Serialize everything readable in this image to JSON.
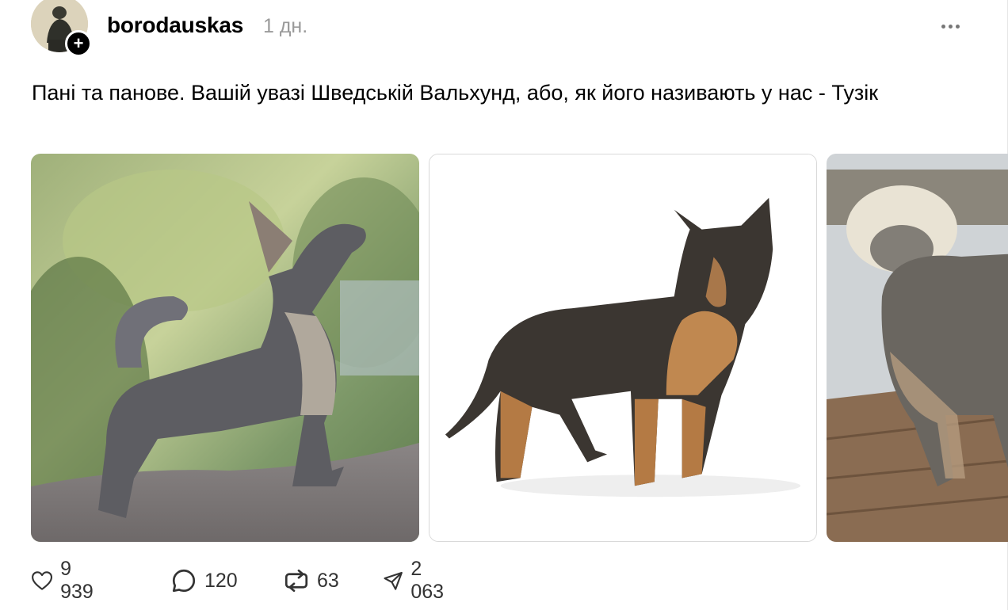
{
  "author": {
    "username": "borodauskas",
    "timestamp": "1 дн.",
    "follow_badge": "+"
  },
  "post": {
    "text": "Пані та панове. Вашій увазі Шведській Вальхунд, або, як його називають у нас - Тузік"
  },
  "gallery": {
    "images": [
      "dog-photo-1",
      "dog-photo-2",
      "dog-photo-3"
    ]
  },
  "actions": {
    "likes": "9 939",
    "comments": "120",
    "reposts": "63",
    "shares": "2 063"
  },
  "colors": {
    "text": "#000000",
    "muted": "#9a9a9a",
    "icon": "#333333"
  },
  "icons": [
    "more-icon",
    "heart-icon",
    "comment-icon",
    "repost-icon",
    "share-icon",
    "plus-icon"
  ]
}
